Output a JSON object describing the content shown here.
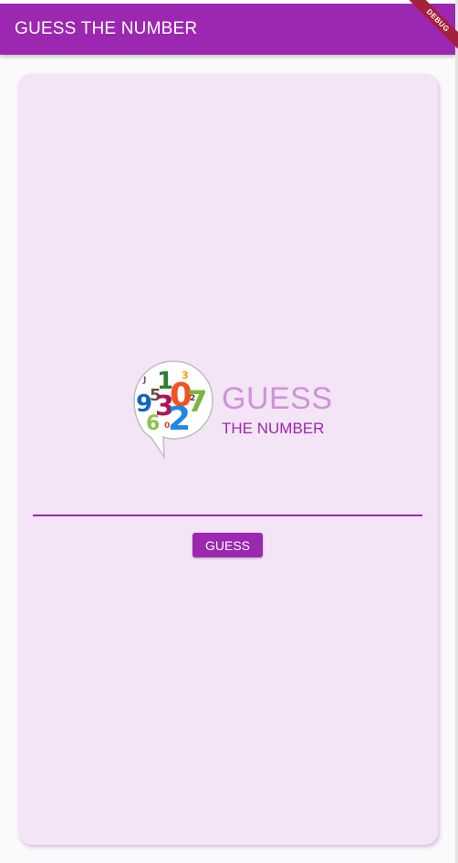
{
  "app_bar": {
    "title": "GUESS THE NUMBER",
    "color": "#9c27b0"
  },
  "debug_banner": {
    "label": "DEBUG",
    "color": "#a5203a"
  },
  "logo": {
    "icon": "number-bubble-icon",
    "title": "GUESS",
    "subtitle": "THE NUMBER"
  },
  "input": {
    "value": "",
    "placeholder": ""
  },
  "guess_button": {
    "label": "GUESS"
  },
  "colors": {
    "accent": "#9c27b0",
    "card_background": "#f3e5f5",
    "logo_title": "#ce93d8"
  }
}
